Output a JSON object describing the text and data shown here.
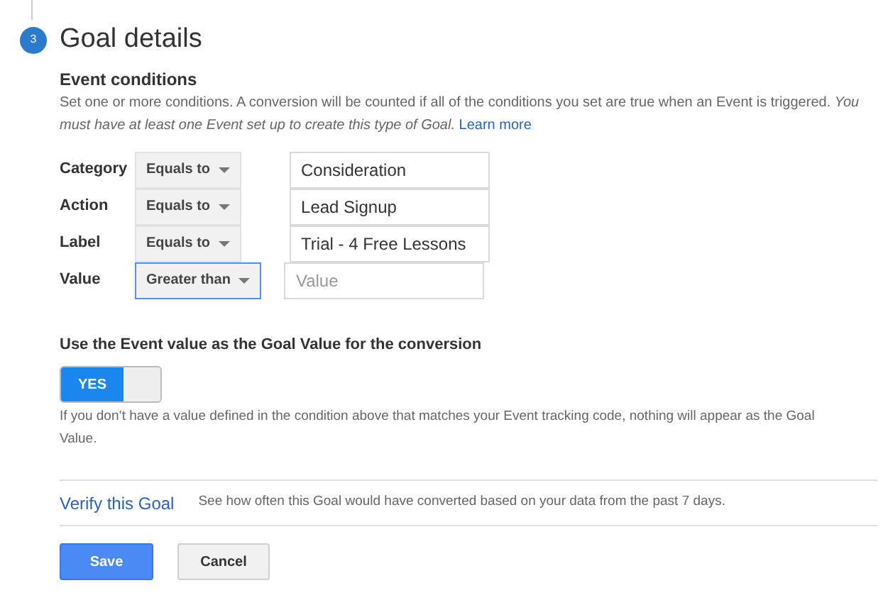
{
  "step": {
    "number": "3",
    "title": "Goal details"
  },
  "event_conditions": {
    "heading": "Event conditions",
    "description": "Set one or more conditions. A conversion will be counted if all of the conditions you set are true when an Event is triggered. *You must have at least one Event set up to create this type of Goal.*",
    "link": "Learn more"
  },
  "conditions": [
    {
      "label": "Category",
      "operator": "Equals to",
      "focused": false,
      "value": "Consideration"
    },
    {
      "label": "Action",
      "operator": "Equals to",
      "focused": false,
      "value": "Lead Signup"
    },
    {
      "label": "Label",
      "operator": "Equals to",
      "focused": false,
      "value": "Trial - 4 Free Lessons"
    },
    {
      "label": "Value",
      "operator": "Greater than",
      "focused": true,
      "placeholder": "Value"
    }
  ],
  "goal_value": {
    "heading": "Use the Event value as the Goal Value for the conversion",
    "toggle": {
      "on": true,
      "label": "YES"
    },
    "note": "If you don’t have a value defined in the condition above that matches your Event tracking code, nothing will appear as the Goal Value."
  },
  "verify": {
    "link": "Verify this Goal",
    "text": "See how often this Goal would have converted based on your data from the past 7 days."
  },
  "buttons": [
    {
      "kind": "primary",
      "label": "Save"
    },
    {
      "kind": "secondary",
      "label": "Cancel"
    }
  ]
}
